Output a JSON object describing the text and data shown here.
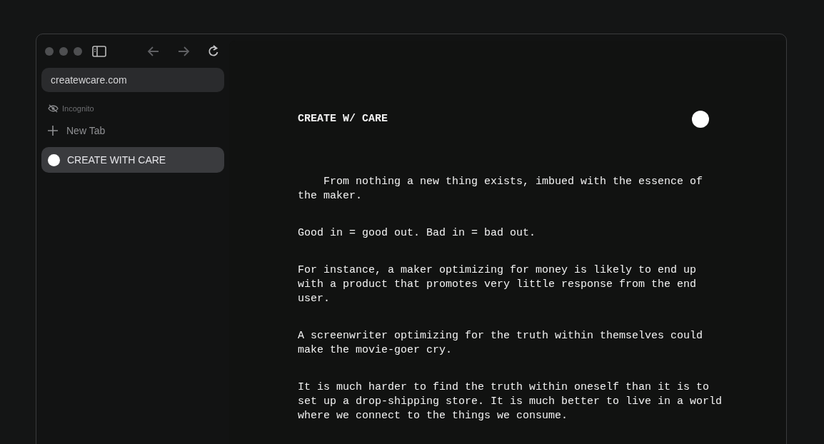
{
  "sidebar": {
    "address": "createwcare.com",
    "incognito": "Incognito",
    "new_tab": "New Tab",
    "tabs": [
      {
        "title": "CREATE WITH CARE",
        "selected": true
      }
    ]
  },
  "page": {
    "title": "CREATE W/ CARE",
    "paragraphs": [
      {
        "lines": [
          "    From nothing a new thing exists, imbued with the essence of",
          "the maker."
        ]
      },
      {
        "lines": [
          "Good in = good out. Bad in = bad out."
        ]
      },
      {
        "lines": [
          "For instance, a maker optimizing for money is likely to end up",
          "with a product that promotes very little response from the end",
          "user."
        ]
      },
      {
        "lines": [
          "A screenwriter optimizing for the truth within themselves could",
          "make the movie-goer cry."
        ]
      },
      {
        "lines": [
          "It is much harder to find the truth within oneself than it is to",
          "set up a drop-shipping store. It is much better to live in a world",
          "where we connect to the things we consume."
        ]
      }
    ]
  }
}
